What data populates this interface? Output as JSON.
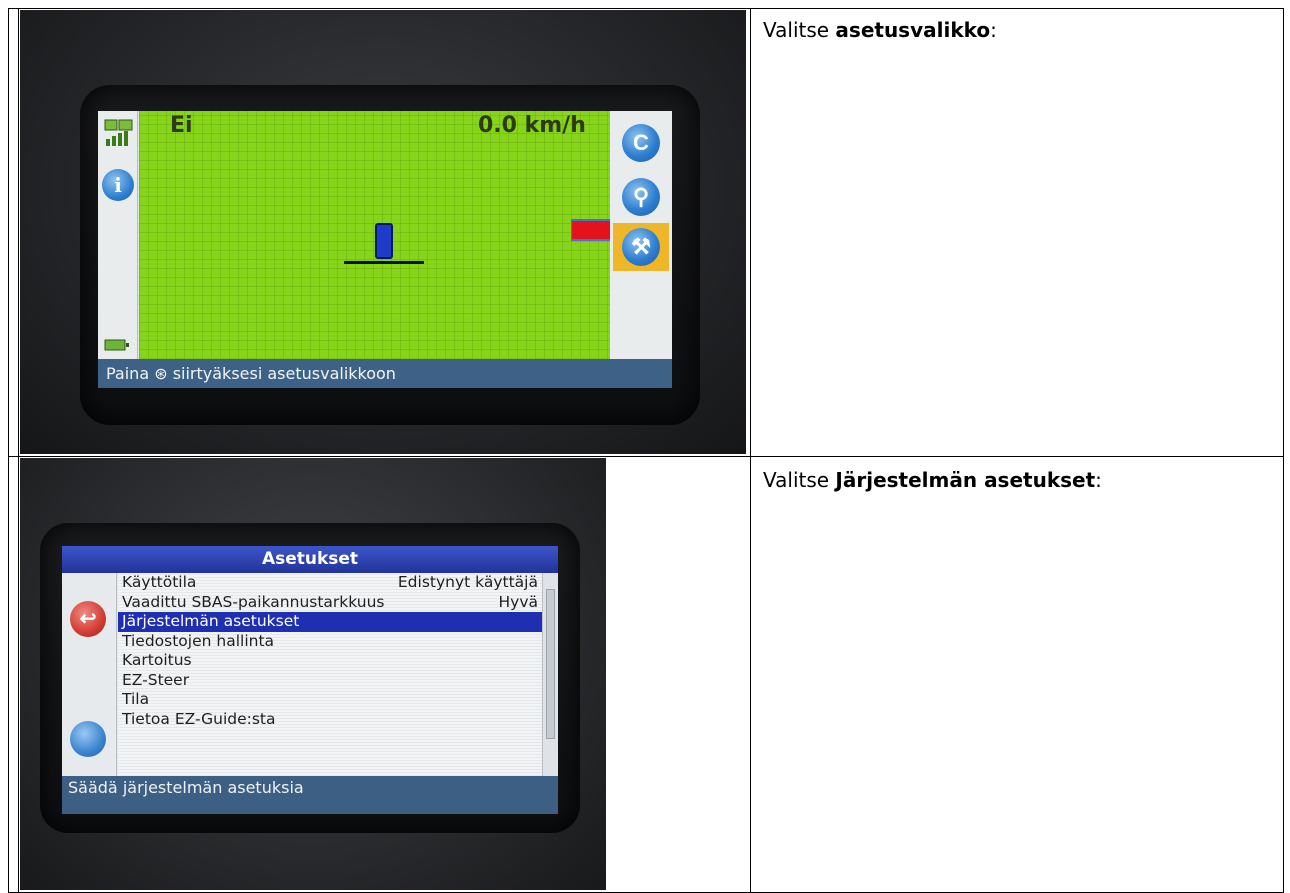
{
  "rows": [
    {
      "instruction": {
        "prefix": "Valitse ",
        "bold": "asetusvalikko",
        "suffix": ":"
      },
      "screen": {
        "guidance_label": "Ei",
        "speed": "0.0 km/h",
        "status_text": "Paina ⊛ siirtyäksesi asetusvalikkoon",
        "info_glyph": "i",
        "side_buttons": [
          {
            "icon": "refresh-icon",
            "glyph": "C"
          },
          {
            "icon": "magnifier-icon",
            "glyph": "⚲"
          },
          {
            "icon": "wrench-icon",
            "glyph": "⚒"
          }
        ]
      }
    },
    {
      "instruction": {
        "prefix": "Valitse ",
        "bold": "Järjestelmän asetukset",
        "suffix": ":"
      },
      "screen": {
        "title": "Asetukset",
        "back_glyph": "↩",
        "menu": [
          {
            "label": "Käyttötila",
            "value": "Edistynyt käyttäjä"
          },
          {
            "label": "Vaadittu SBAS-paikannustarkkuus",
            "value": "Hyvä"
          },
          {
            "label": "Järjestelmän asetukset",
            "value": ""
          },
          {
            "label": "Tiedostojen hallinta",
            "value": ""
          },
          {
            "label": "Kartoitus",
            "value": ""
          },
          {
            "label": "EZ-Steer",
            "value": ""
          },
          {
            "label": "Tila",
            "value": ""
          },
          {
            "label": "Tietoa EZ-Guide:sta",
            "value": ""
          }
        ],
        "selected_index": 2,
        "status_text": "Säädä järjestelmän asetuksia"
      }
    }
  ],
  "colors": {
    "field_green": "#86d51b",
    "highlight_blue": "#1f2fb2",
    "arrow_red": "#e3121b",
    "active_button": "#f0b62a"
  }
}
